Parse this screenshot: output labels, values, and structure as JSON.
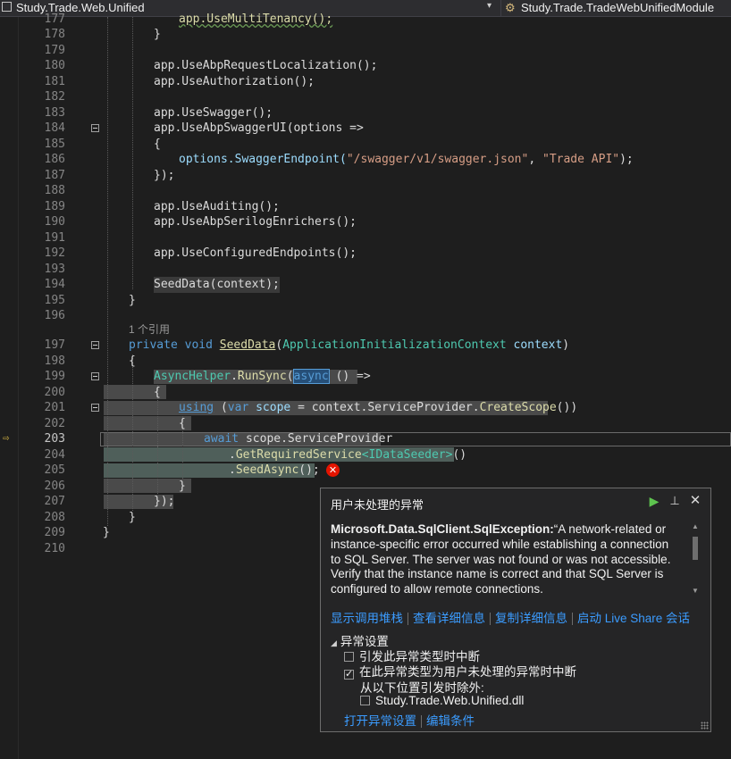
{
  "navbar": {
    "project": "Study.Trade.Web.Unified",
    "class": "Study.Trade.TradeWebUnifiedModule",
    "dropdown_glyph": "▾",
    "project_icon": "csharp-project-icon",
    "class_icon": "class-icon"
  },
  "editor": {
    "current_line": "203",
    "lines": [
      {
        "num": "177",
        "tokens": []
      },
      {
        "num": "178",
        "tokens": []
      },
      {
        "num": "179",
        "tokens": []
      },
      {
        "num": "180",
        "tokens": []
      },
      {
        "num": "181",
        "tokens": []
      },
      {
        "num": "182",
        "tokens": []
      },
      {
        "num": "183",
        "tokens": []
      },
      {
        "num": "184",
        "tokens": []
      },
      {
        "num": "185",
        "tokens": []
      },
      {
        "num": "186",
        "tokens": []
      },
      {
        "num": "187",
        "tokens": []
      },
      {
        "num": "188",
        "tokens": []
      },
      {
        "num": "189",
        "tokens": []
      },
      {
        "num": "190",
        "tokens": []
      },
      {
        "num": "191",
        "tokens": []
      },
      {
        "num": "192",
        "tokens": []
      },
      {
        "num": "193",
        "tokens": []
      },
      {
        "num": "194",
        "tokens": []
      },
      {
        "num": "195",
        "tokens": []
      },
      {
        "num": "196",
        "tokens": []
      },
      {
        "num": "",
        "tokens": []
      },
      {
        "num": "197",
        "tokens": []
      },
      {
        "num": "198",
        "tokens": []
      },
      {
        "num": "199",
        "tokens": []
      },
      {
        "num": "200",
        "tokens": []
      },
      {
        "num": "201",
        "tokens": []
      },
      {
        "num": "202",
        "tokens": []
      },
      {
        "num": "203",
        "tokens": []
      },
      {
        "num": "204",
        "tokens": []
      },
      {
        "num": "205",
        "tokens": []
      },
      {
        "num": "206",
        "tokens": []
      },
      {
        "num": "207",
        "tokens": []
      },
      {
        "num": "208",
        "tokens": []
      },
      {
        "num": "209",
        "tokens": []
      },
      {
        "num": "210",
        "tokens": []
      }
    ],
    "code": {
      "l177": "app.UseMultiTenancy();",
      "l178": "}",
      "l180": "app.UseAbpRequestLocalization();",
      "l181": "app.UseAuthorization();",
      "l183": "app.UseSwagger();",
      "l184": "app.UseAbpSwaggerUI(options =>",
      "l185": "{",
      "l186a": "options.SwaggerEndpoint(",
      "l186b": "\"/swagger/v1/swagger.json\"",
      "l186c": ", ",
      "l186d": "\"Trade API\"",
      "l186e": ");",
      "l187": "});",
      "l189": "app.UseAuditing();",
      "l190": "app.UseAbpSerilogEnrichers();",
      "l192": "app.UseConfiguredEndpoints();",
      "l194": "SeedData(context);",
      "l195": "}",
      "ref_count": "1 个引用",
      "l197_private": "private",
      "l197_void": "void",
      "l197_name": "SeedData",
      "l197_type": "ApplicationInitializationContext",
      "l197_param": "context",
      "l198": "{",
      "l199_type": "AsyncHelper",
      "l199_fn": "RunSync",
      "l199_async": "async",
      "l199_rest": "() =>",
      "l200": "{",
      "l201_using": "using",
      "l201_var": "var",
      "l201_scope": "scope",
      "l201_rest": "= context.ServiceProvider.",
      "l201_fn": "CreateScope",
      "l201_end": "())",
      "l202": "{",
      "l203_await": "await",
      "l203_rest": "scope.ServiceProvider",
      "l204_a": ".",
      "l204_fn": "GetRequiredService",
      "l204_ty": "<IDataSeeder>",
      "l204_end": "()",
      "l205_a": ".",
      "l205_fn": "SeedAsync",
      "l205_end": "();",
      "l206": "}",
      "l207": "});",
      "l208": "}",
      "l209": "}"
    }
  },
  "exception": {
    "title": "用户未处理的异常",
    "play_icon": "continue-icon",
    "pin_icon": "pin-icon",
    "close_icon": "close-icon",
    "exception_type": "Microsoft.Data.SqlClient.SqlException:",
    "message": "“A network-related or instance-specific error occurred while establishing a connection to SQL Server. The server was not found or was not accessible. Verify that the instance name is correct and that SQL Server is configured to allow remote connections.",
    "links": [
      "显示调用堆栈",
      "查看详细信息",
      "复制详细信息",
      "启动 Live Share 会话"
    ],
    "settings_header": "异常设置",
    "option_break_thrown": "引发此异常类型时中断",
    "option_break_unhandled": "在此异常类型为用户未处理的异常时中断",
    "option_break_unhandled_checked": true,
    "except_from": "从以下位置引发时除外:",
    "except_dll": "Study.Trade.Web.Unified.dll",
    "bottom_links": [
      "打开异常设置",
      "编辑条件"
    ]
  }
}
